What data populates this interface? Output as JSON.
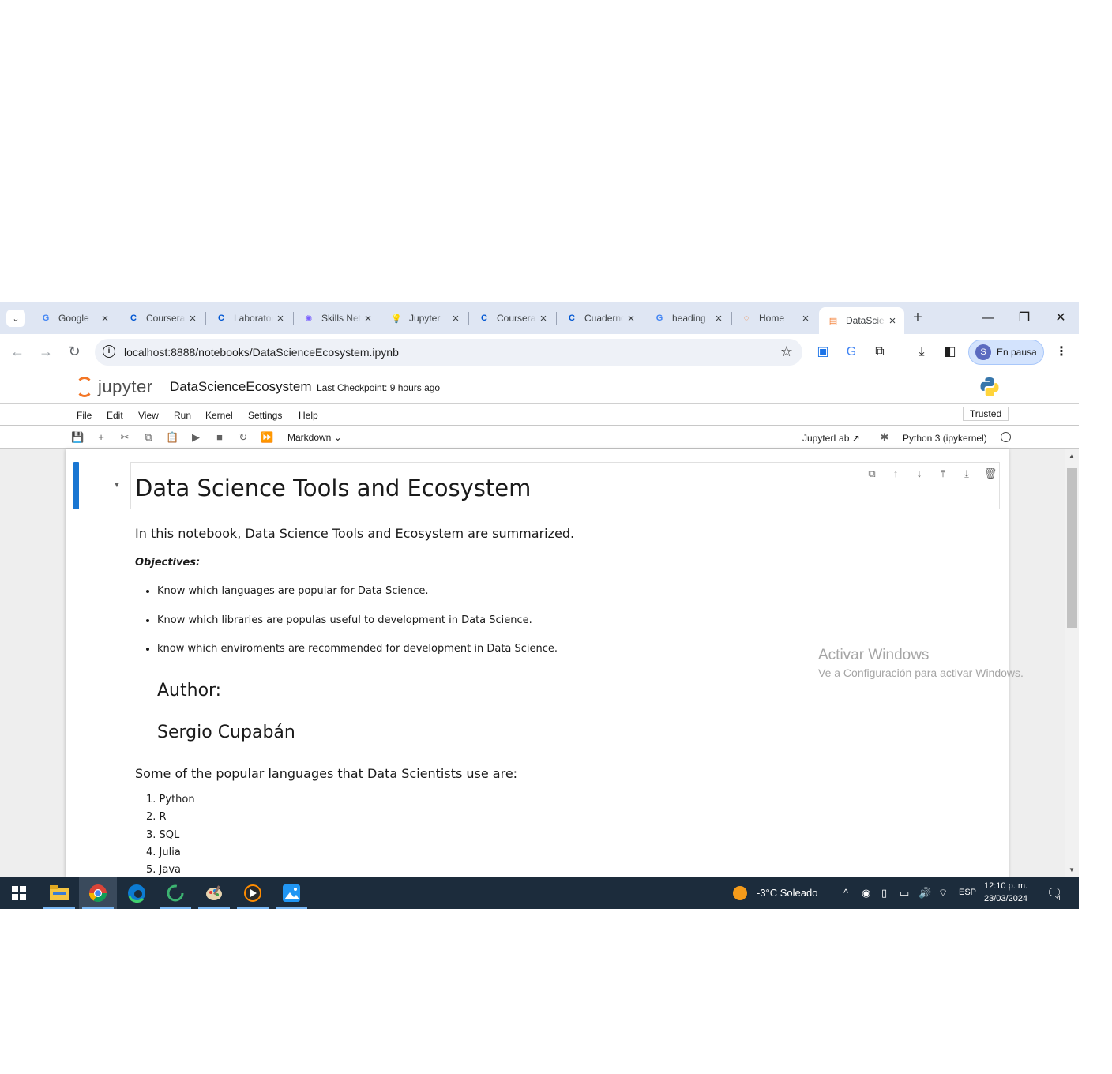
{
  "browser": {
    "tabs": [
      {
        "title": "Google",
        "favicon": "google-translate-icon",
        "color": "#4285f4"
      },
      {
        "title": "Coursera",
        "favicon": "coursera-icon",
        "color": "#0056d2"
      },
      {
        "title": "Laboratory",
        "favicon": "coursera-icon",
        "color": "#0056d2"
      },
      {
        "title": "Skills Network",
        "favicon": "skills-network-icon",
        "color": "#7b61ff"
      },
      {
        "title": "Jupyter",
        "favicon": "jupyter-bulb-icon",
        "color": "#f2b01e"
      },
      {
        "title": "Coursera",
        "favicon": "coursera-icon",
        "color": "#0056d2"
      },
      {
        "title": "Cuaderno",
        "favicon": "coursera-icon",
        "color": "#0056d2"
      },
      {
        "title": "heading",
        "favicon": "google-icon",
        "color": "#4285f4"
      },
      {
        "title": "Home",
        "favicon": "jupyter-icon",
        "color": "#f37626"
      },
      {
        "title": "DataScienceEcosystem",
        "favicon": "notebook-icon",
        "color": "#f37626",
        "active": true
      }
    ],
    "url": "localhost:8888/notebooks/DataScienceEcosystem.ipynb",
    "profile_initial": "S",
    "profile_label": "En pausa"
  },
  "jupyter": {
    "logo_text": "jupyter",
    "notebook_name": "DataScienceEcosystem",
    "checkpoint": "Last Checkpoint: 9 hours ago",
    "menu": [
      "File",
      "Edit",
      "View",
      "Run",
      "Kernel",
      "Settings",
      "Help"
    ],
    "trusted": "Trusted",
    "cell_type": "Markdown",
    "jupyterlab_link": "JupyterLab",
    "kernel": "Python 3 (ipykernel)"
  },
  "notebook": {
    "title": "Data Science Tools and Ecosystem",
    "intro": "In this notebook, Data Science Tools and Ecosystem are summarized.",
    "objectives_label": "Objectives:",
    "objectives": [
      "Know which languages are popular for Data Science.",
      "Know which libraries are populas useful to development in Data Science.",
      "know which enviroments are recommended for development in Data Science."
    ],
    "author_label": "Author:",
    "author_name": "Sergio Cupabán",
    "languages_intro": "Some of the popular languages that Data Scientists use are:",
    "languages": [
      "1. Python",
      "2. R",
      "3. SQL",
      "4. Julia",
      "5. Java"
    ]
  },
  "watermark": {
    "line1": "Activar Windows",
    "line2": "Ve a Configuración para activar Windows."
  },
  "taskbar": {
    "weather": "-3°C  Soleado",
    "lang": "ESP",
    "time": "12:10 p. m.",
    "date": "23/03/2024",
    "notifications": "4"
  },
  "colors": {
    "accent": "#1976d2",
    "jupyter_orange": "#f37626",
    "taskbar": "#1c2c3c"
  }
}
